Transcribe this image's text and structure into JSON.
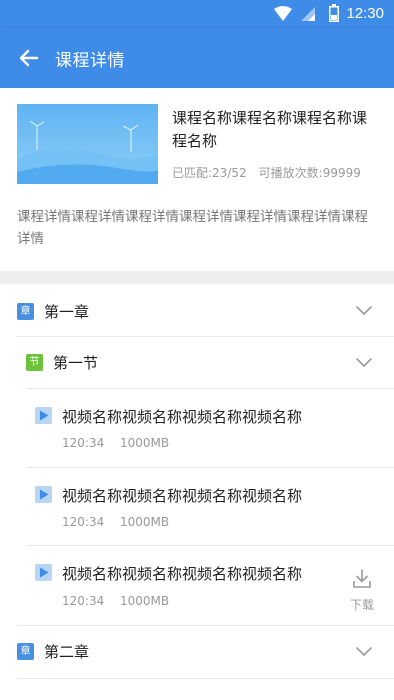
{
  "status_bar": {
    "time": "12:30",
    "icons": [
      "wifi-icon",
      "signal-icon",
      "battery-icon"
    ]
  },
  "app_bar": {
    "title": "课程详情",
    "back_icon": "arrow-left-icon"
  },
  "course": {
    "title": "课程名称课程名称课程名称课程名称",
    "matched_label": "已匹配:",
    "matched_value": "23/52",
    "plays_label": "可播放次数:",
    "plays_value": "99999",
    "description": "课程详情课程详情课程详情课程详情课程详情课程详情课程详情"
  },
  "chapters": [
    {
      "badge": "章",
      "title": "第一章",
      "expanded": true,
      "sections": [
        {
          "badge": "节",
          "title": "第一节",
          "expanded": true,
          "videos": [
            {
              "title": "视频名称视频名称视频名称视频名称",
              "duration": "120:34",
              "size": "1000MB",
              "download_visible": false
            },
            {
              "title": "视频名称视频名称视频名称视频名称",
              "duration": "120:34",
              "size": "1000MB",
              "download_visible": false
            },
            {
              "title": "视频名称视频名称视频名称视频名称",
              "duration": "120:34",
              "size": "1000MB",
              "download_visible": true,
              "download_label": "下载"
            }
          ]
        }
      ]
    },
    {
      "badge": "章",
      "title": "第二章",
      "expanded": false,
      "sections": []
    }
  ],
  "colors": {
    "primary": "#3e8ce8",
    "chapter_badge": "#4a90e2",
    "section_badge": "#6cc23a",
    "video_icon_bg": "#b9d5f5",
    "video_icon_fg": "#3e8ce8"
  }
}
